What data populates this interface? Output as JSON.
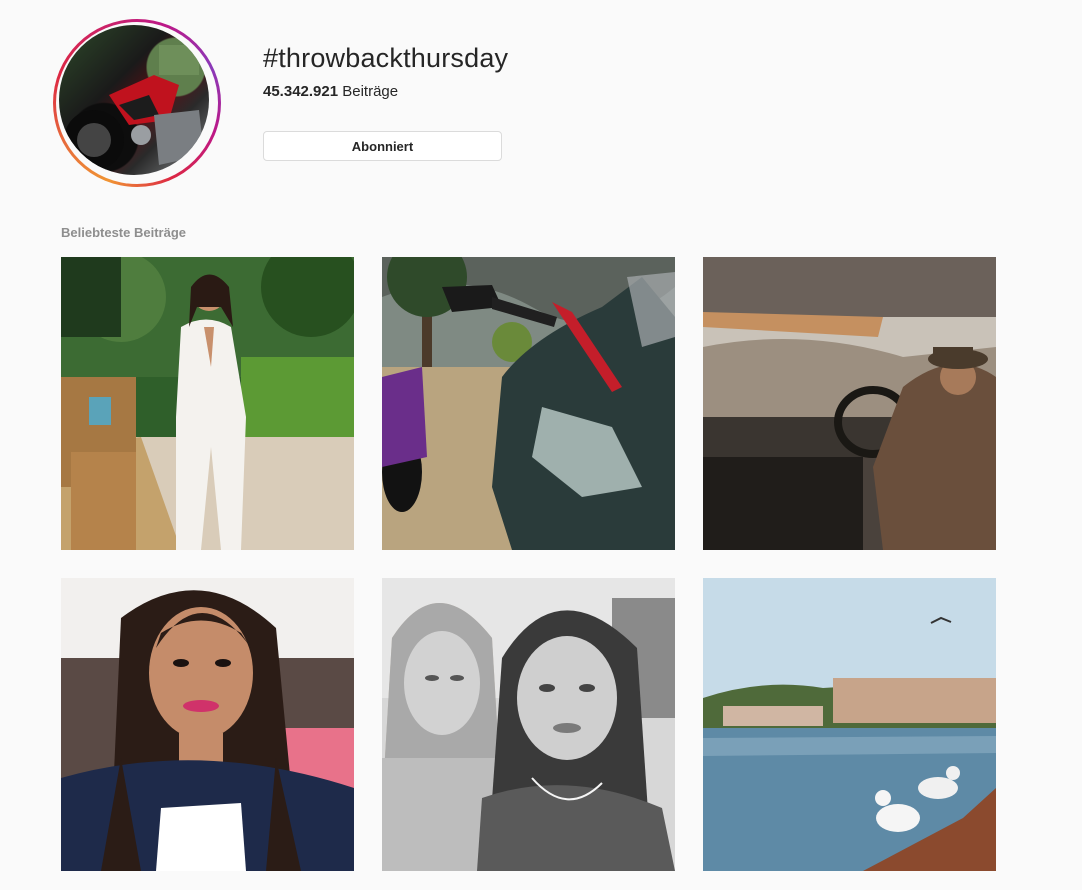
{
  "hashtag": {
    "title": "#throwbackthursday",
    "post_count": "45.342.921",
    "post_count_suffix": "Beiträge",
    "follow_button_label": "Abonniert",
    "avatar_icon": "hashtag-avatar-motorcycle"
  },
  "section": {
    "label": "Beliebteste Beiträge"
  },
  "posts": [
    {
      "subject": "woman-white-jumpsuit-garden"
    },
    {
      "subject": "honda-motorcycle-closeup"
    },
    {
      "subject": "man-driving-car-interior"
    },
    {
      "subject": "woman-selfie-long-hair"
    },
    {
      "subject": "two-women-black-and-white"
    },
    {
      "subject": "seagulls-harbor-city-view"
    }
  ],
  "colors": {
    "background": "#fafafa",
    "text": "#262626",
    "muted": "#8e8e8e",
    "border": "#dbdbdb",
    "ring_start": "#f09433",
    "ring_end": "#bc1888"
  }
}
